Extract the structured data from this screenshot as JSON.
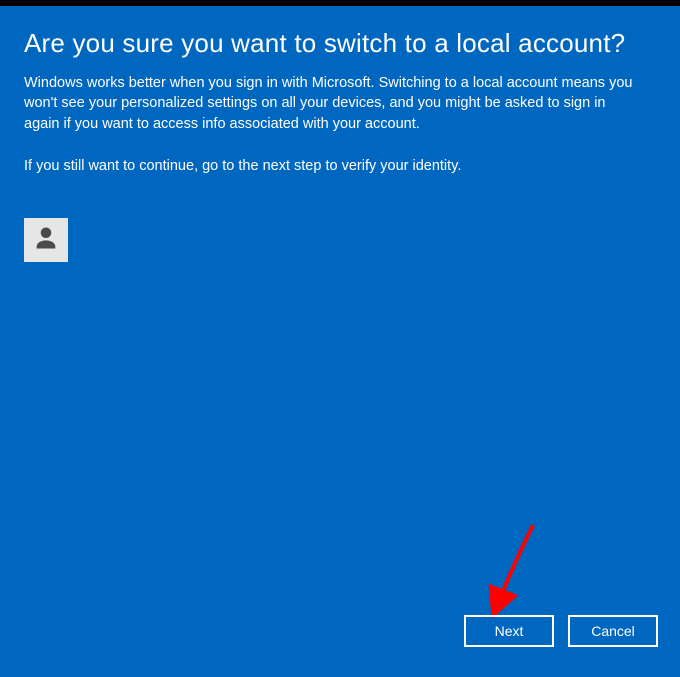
{
  "dialog": {
    "title": "Are you sure you want to switch to a local account?",
    "description": "Windows works better when you sign in with Microsoft. Switching to a local account means you won't see your personalized settings on all your devices, and you might be asked to sign in again if you want to access info associated with your account.",
    "instruction": "If you still want to continue, go to the next step to verify your identity."
  },
  "user": {
    "name": "",
    "email": ""
  },
  "buttons": {
    "next": "Next",
    "cancel": "Cancel"
  },
  "icons": {
    "user": "user-icon"
  },
  "colors": {
    "background": "#0067c0",
    "text": "#ffffff",
    "avatar_bg": "#e6e6e6",
    "avatar_fg": "#4a4a4a",
    "annotation_arrow": "#ff0000"
  }
}
